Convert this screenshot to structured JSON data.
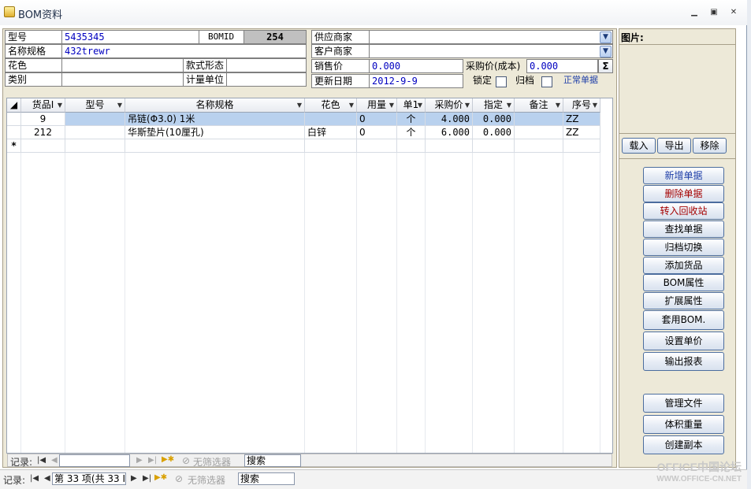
{
  "window": {
    "title": "BOM资料",
    "minimize": "▭",
    "restore": "▣",
    "close": "✕"
  },
  "header": {
    "model_label": "型号",
    "model_value": "5435345",
    "bomid_label": "BOMID",
    "bomid_value": "254",
    "name_label": "名称规格",
    "name_value": "432trewr",
    "color_label": "花色",
    "color_value": "",
    "style_label": "款式形态",
    "style_value": "",
    "category_label": "类别",
    "category_value": "",
    "unit_label": "计量单位",
    "unit_value": "",
    "supplier_label": "供应商家",
    "supplier_value": "",
    "customer_label": "客户商家",
    "customer_value": "",
    "sale_price_label": "销售价",
    "sale_price_value": "0.000",
    "cost_price_label": "采购价(成本)",
    "cost_price_value": "0.000",
    "sigma_label": "Σ",
    "update_date_label": "更新日期",
    "update_date_value": "2012-9-9",
    "lock_label": "锁定",
    "archive_label": "归档",
    "status_text": "正常单据"
  },
  "grid": {
    "columns": [
      "货品I",
      "型号",
      "名称规格",
      "花色",
      "用量",
      "单1",
      "采购价",
      "指定",
      "备注",
      "序号"
    ],
    "rows": [
      {
        "id": "9",
        "model": "",
        "name": "吊链(Φ3.0) 1米",
        "color": "",
        "qty": "0",
        "unit": "个",
        "price": "4.000",
        "fixed": "0.000",
        "remark": "",
        "seq": "ZZ"
      },
      {
        "id": "212",
        "model": "",
        "name": "华斯垫片(10厘孔)",
        "color": "白锌",
        "qty": "0",
        "unit": "个",
        "price": "6.000",
        "fixed": "0.000",
        "remark": "",
        "seq": "ZZ"
      }
    ],
    "new_row_marker": "*"
  },
  "subnav": {
    "label": "记录:",
    "filter": "无筛选器",
    "search": "搜索"
  },
  "mainnav": {
    "label": "记录:",
    "position": "第 33 项(共 33 I",
    "filter": "无筛选器",
    "search": "搜索"
  },
  "picture": {
    "label": "图片:",
    "load": "载入",
    "export": "导出",
    "remove": "移除"
  },
  "actions": {
    "new": "新增单据",
    "delete": "删除单据",
    "recycle": "转入回收站",
    "find": "查找单据",
    "archive_toggle": "归档切换",
    "add_goods": "添加货品",
    "bom_attr": "BOM属性",
    "ext_attr": "扩展属性",
    "apply_bom": "套用BOM.",
    "set_price": "设置单价",
    "output_report": "输出报表",
    "manage_files": "管理文件",
    "volume_weight": "体积重量",
    "create_copy": "创建副本"
  },
  "watermark": {
    "line1": "OFFICE中国论坛",
    "line2": "WWW.OFFICE-CN.NET"
  }
}
